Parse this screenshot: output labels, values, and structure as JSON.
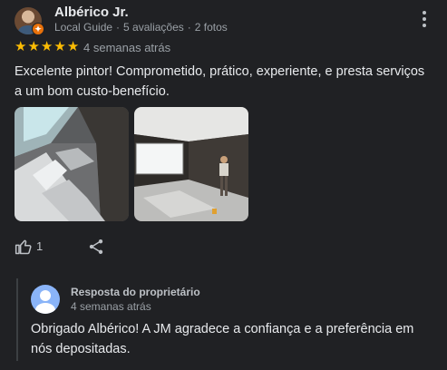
{
  "reviewer": {
    "name": "Albérico Jr.",
    "badge": "Local Guide",
    "reviews": "5 avaliações",
    "photos": "2 fotos"
  },
  "rating": {
    "value": 5,
    "max": 5,
    "color": "#fbbc04"
  },
  "review": {
    "date": "4 semanas atrás",
    "text": "Excelente pintor! Comprometido, prático, experiente, e presta serviços a um bom custo-benefício."
  },
  "photos": [
    {
      "icon": "living-room-photo"
    },
    {
      "icon": "painter-room-photo"
    }
  ],
  "actions": {
    "like_count": "1"
  },
  "owner_reply": {
    "title": "Resposta do proprietário",
    "date": "4 semanas atrás",
    "text": "Obrigado Albérico! A JM agradece a confiança e a preferência em nós depositadas."
  }
}
